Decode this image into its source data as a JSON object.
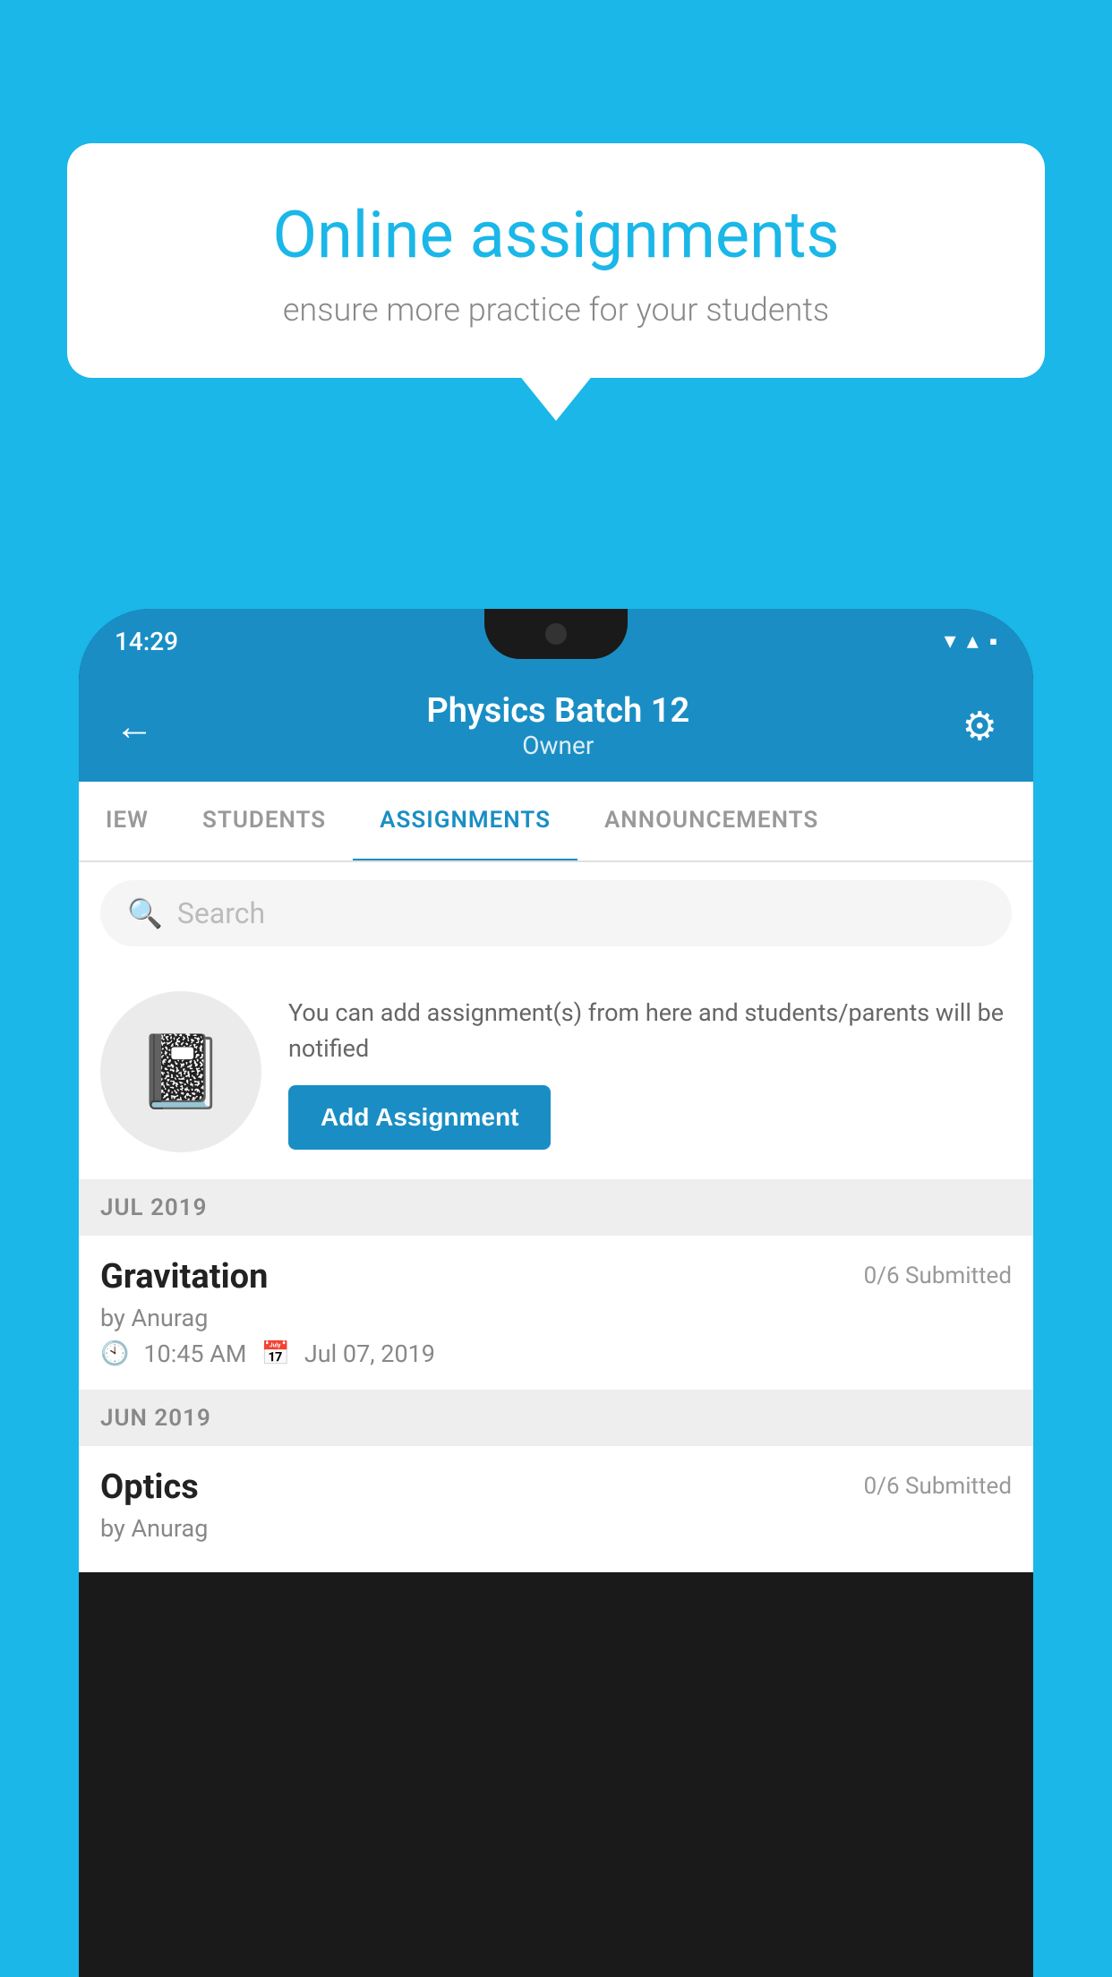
{
  "background": {
    "color": "#1ab7e8"
  },
  "speech_bubble": {
    "title": "Online assignments",
    "subtitle": "ensure more practice for your students"
  },
  "status_bar": {
    "time": "14:29",
    "wifi_icon": "▼",
    "signal_icon": "▲",
    "battery_icon": "▪"
  },
  "header": {
    "back_label": "←",
    "title": "Physics Batch 12",
    "subtitle": "Owner",
    "gear_label": "⚙"
  },
  "tabs": [
    {
      "label": "IEW",
      "active": false
    },
    {
      "label": "STUDENTS",
      "active": false
    },
    {
      "label": "ASSIGNMENTS",
      "active": true
    },
    {
      "label": "ANNOUNCEMENTS",
      "active": false
    }
  ],
  "search": {
    "placeholder": "Search"
  },
  "promo": {
    "text": "You can add assignment(s) from here and students/parents will be notified",
    "button_label": "Add Assignment"
  },
  "sections": [
    {
      "label": "JUL 2019",
      "assignments": [
        {
          "name": "Gravitation",
          "submitted": "0/6 Submitted",
          "author": "by Anurag",
          "time": "10:45 AM",
          "date": "Jul 07, 2019"
        }
      ]
    },
    {
      "label": "JUN 2019",
      "assignments": [
        {
          "name": "Optics",
          "submitted": "0/6 Submitted",
          "author": "by Anurag",
          "time": "",
          "date": ""
        }
      ]
    }
  ]
}
